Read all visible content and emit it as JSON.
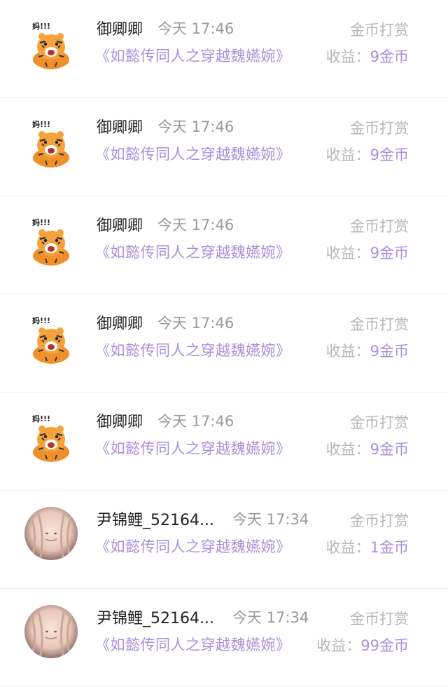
{
  "colors": {
    "accent": "#a98fdc",
    "muted": "#b6b6b6",
    "time": "#9a9a9a",
    "name": "#222222",
    "divider": "#efefef"
  },
  "income_label": "收益：",
  "records": [
    {
      "avatar": "tiger-avatar",
      "avatar_text": "妈!!!",
      "name": "御卿卿",
      "time": "今天 17:46",
      "type": "金币打赏",
      "book": "《如懿传同人之穿越魏嬿婉》",
      "income": "9金币"
    },
    {
      "avatar": "tiger-avatar",
      "avatar_text": "妈!!!",
      "name": "御卿卿",
      "time": "今天 17:46",
      "type": "金币打赏",
      "book": "《如懿传同人之穿越魏嬿婉》",
      "income": "9金币"
    },
    {
      "avatar": "tiger-avatar",
      "avatar_text": "妈!!!",
      "name": "御卿卿",
      "time": "今天 17:46",
      "type": "金币打赏",
      "book": "《如懿传同人之穿越魏嬿婉》",
      "income": "9金币"
    },
    {
      "avatar": "tiger-avatar",
      "avatar_text": "妈!!!",
      "name": "御卿卿",
      "time": "今天 17:46",
      "type": "金币打赏",
      "book": "《如懿传同人之穿越魏嬿婉》",
      "income": "9金币"
    },
    {
      "avatar": "tiger-avatar",
      "avatar_text": "妈!!!",
      "name": "御卿卿",
      "time": "今天 17:46",
      "type": "金币打赏",
      "book": "《如懿传同人之穿越魏嬿婉》",
      "income": "9金币"
    },
    {
      "avatar": "anime-girl-avatar",
      "name": "尹锦鲤_52164...",
      "time": "今天 17:34",
      "type": "金币打赏",
      "book": "《如懿传同人之穿越魏嬿婉》",
      "income": "1金币"
    },
    {
      "avatar": "anime-girl-avatar",
      "name": "尹锦鲤_52164...",
      "time": "今天 17:34",
      "type": "金币打赏",
      "book": "《如懿传同人之穿越魏嬿婉》",
      "income": "99金币"
    }
  ]
}
